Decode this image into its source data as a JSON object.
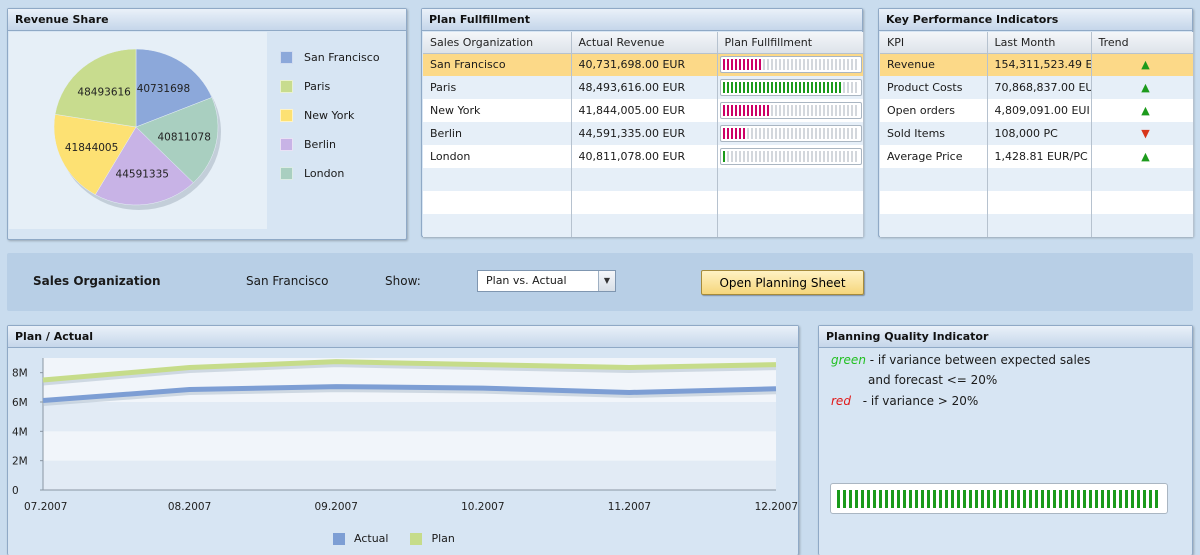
{
  "revenue_share": {
    "title": "Revenue Share",
    "slices": [
      {
        "city": "San Francisco",
        "value": 40731698,
        "label": "40731698",
        "color": "#8ca8da"
      },
      {
        "city": "Paris",
        "value": 48493616,
        "label": "48493616",
        "color": "#c8dc8e"
      },
      {
        "city": "New York",
        "value": 41844005,
        "label": "41844005",
        "color": "#fde173"
      },
      {
        "city": "Berlin",
        "value": 44591335,
        "label": "44591335",
        "color": "#c8b3e6"
      },
      {
        "city": "London",
        "value": 40811078,
        "label": "40811078",
        "color": "#a9cfc0"
      }
    ]
  },
  "plan_fulfillment": {
    "title": "Plan Fullfillment",
    "columns": [
      "Sales Organization",
      "Actual Revenue",
      "Plan Fullfillment"
    ],
    "rows": [
      {
        "org": "San Francisco",
        "revenue": "40,731,698.00 EUR",
        "fill_ticks": 10,
        "bar_color": "#cc0066"
      },
      {
        "org": "Paris",
        "revenue": "48,493,616.00 EUR",
        "fill_ticks": 30,
        "bar_color": "#1a9a1a"
      },
      {
        "org": "New York",
        "revenue": "41,844,005.00 EUR",
        "fill_ticks": 12,
        "bar_color": "#cc0066"
      },
      {
        "org": "Berlin",
        "revenue": "44,591,335.00 EUR",
        "fill_ticks": 6,
        "bar_color": "#cc0066"
      },
      {
        "org": "London",
        "revenue": "40,811,078.00 EUR",
        "fill_ticks": 1,
        "bar_color": "#1a9a1a"
      }
    ],
    "total_ticks": 34
  },
  "kpi": {
    "title": "Key Performance Indicators",
    "columns": [
      "KPI",
      "Last Month",
      "Trend"
    ],
    "rows": [
      {
        "kpi": "Revenue",
        "value": "154,311,523.49 E",
        "trend": "up"
      },
      {
        "kpi": "Product Costs",
        "value": "70,868,837.00 EU",
        "trend": "up"
      },
      {
        "kpi": "Open orders",
        "value": "4,809,091.00 EUI",
        "trend": "up"
      },
      {
        "kpi": "Sold Items",
        "value": "108,000 PC",
        "trend": "down"
      },
      {
        "kpi": "Average Price",
        "value": "1,428.81 EUR/PC",
        "trend": "up"
      }
    ]
  },
  "filter_bar": {
    "org_label": "Sales Organization",
    "org_value": "San Francisco",
    "show_label": "Show:",
    "show_value": "Plan vs. Actual",
    "button_label": "Open Planning Sheet"
  },
  "plan_actual": {
    "title": "Plan / Actual",
    "legend_actual": "Actual",
    "legend_plan": "Plan"
  },
  "chart_data": {
    "type": "area",
    "categories": [
      "07.2007",
      "08.2007",
      "09.2007",
      "10.2007",
      "11.2007",
      "12.2007"
    ],
    "y_ticks": [
      "0",
      "2M",
      "4M",
      "6M",
      "8M"
    ],
    "ylim": [
      0,
      9000000
    ],
    "series": [
      {
        "name": "Actual",
        "values": [
          6100000,
          6850000,
          7050000,
          6950000,
          6650000,
          6900000
        ],
        "color": "#7d9ed4"
      },
      {
        "name": "Plan",
        "values": [
          7500000,
          8350000,
          8750000,
          8550000,
          8350000,
          8550000
        ],
        "color": "#c6dc8a"
      }
    ]
  },
  "pqi": {
    "title": "Planning Quality Indicator",
    "green_word": "green",
    "green_text": "- if variance between expected sales",
    "green_text2": "and forecast <= 20%",
    "red_word": "red",
    "red_text": "- if variance > 20%",
    "ticks": 54,
    "bar_color": "#1a9a1a"
  },
  "colors": {
    "up": "#1c9a1c",
    "down": "#d8361b",
    "selected_row": "#fcd988"
  }
}
